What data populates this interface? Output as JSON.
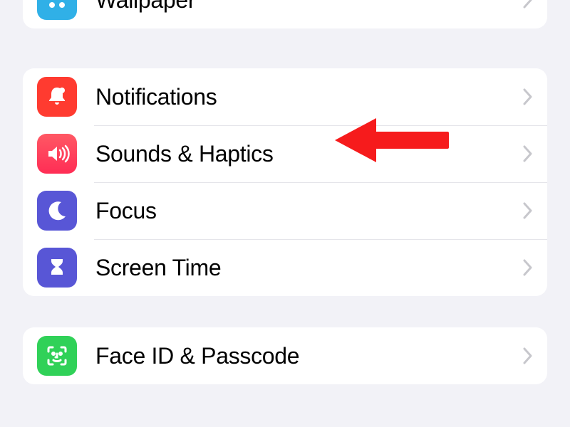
{
  "group0": {
    "items": [
      {
        "label": "Wallpaper",
        "icon": "wallpaper-icon",
        "icon_color": "#30b0e7"
      }
    ]
  },
  "group1": {
    "items": [
      {
        "label": "Notifications",
        "icon": "bell-icon",
        "icon_color": "#ff3b30"
      },
      {
        "label": "Sounds & Haptics",
        "icon": "speaker-icon",
        "icon_color": "#ff2d55"
      },
      {
        "label": "Focus",
        "icon": "moon-icon",
        "icon_color": "#5856d6"
      },
      {
        "label": "Screen Time",
        "icon": "hourglass-icon",
        "icon_color": "#5856d6"
      }
    ]
  },
  "group2": {
    "items": [
      {
        "label": "Face ID & Passcode",
        "icon": "faceid-icon",
        "icon_color": "#30d158"
      }
    ]
  },
  "annotation": {
    "type": "arrow",
    "points_to": "Sounds & Haptics",
    "color": "#f61b1c"
  }
}
